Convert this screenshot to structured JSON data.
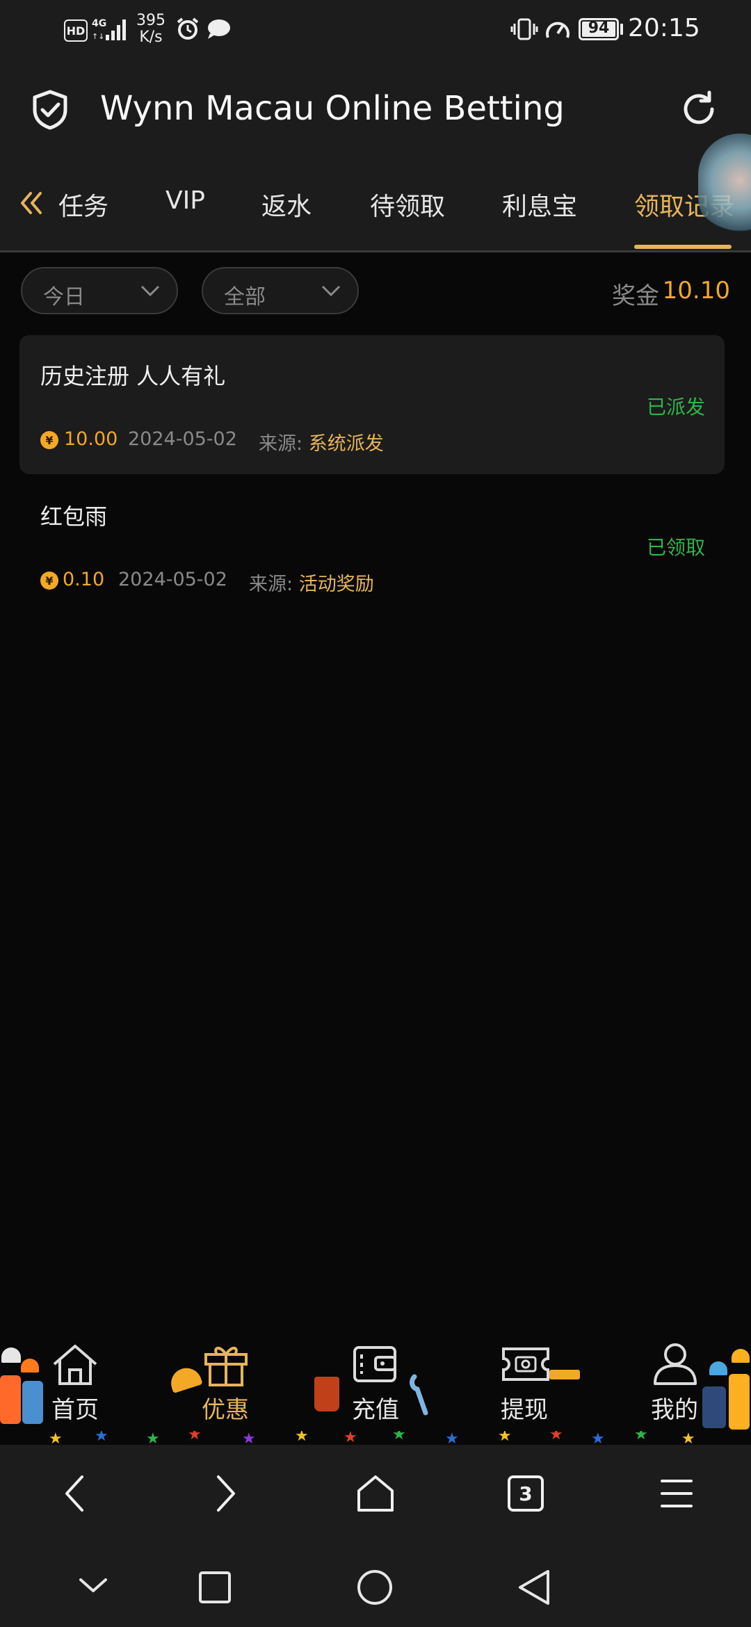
{
  "status_bar": {
    "hd": "HD",
    "network": "4G",
    "speed_value": "395",
    "speed_unit": "K/s",
    "battery": "94",
    "time": "20:15"
  },
  "header": {
    "title": "Wynn Macau Online Betting",
    "icons": [
      "shield-check-icon",
      "refresh-icon"
    ]
  },
  "tabs": {
    "items": [
      {
        "label": "任务"
      },
      {
        "label": "VIP"
      },
      {
        "label": "返水"
      },
      {
        "label": "待领取"
      },
      {
        "label": "利息宝"
      },
      {
        "label": "领取记录"
      }
    ],
    "active_index": 5
  },
  "filters": {
    "date": "今日",
    "type": "全部",
    "bonus_label": "奖金",
    "bonus_value": "10.10"
  },
  "records": [
    {
      "title": "历史注册 人人有礼",
      "status": "已派发",
      "amount": "10.00",
      "date": "2024-05-02",
      "source_label": "来源:",
      "source": "系统派发"
    },
    {
      "title": "红包雨",
      "status": "已领取",
      "amount": "0.10",
      "date": "2024-05-02",
      "source_label": "来源:",
      "source": "活动奖励"
    }
  ],
  "bottom_nav": {
    "items": [
      {
        "label": "首页",
        "icon": "home-icon"
      },
      {
        "label": "优惠",
        "icon": "gift-icon"
      },
      {
        "label": "充值",
        "icon": "wallet-icon"
      },
      {
        "label": "提现",
        "icon": "withdraw-ticket-icon"
      },
      {
        "label": "我的",
        "icon": "profile-icon"
      }
    ],
    "active_index": 1
  },
  "browser_bar": {
    "tab_count": "3"
  },
  "colors": {
    "accent_gold": "#e6b45a",
    "amount_orange": "#f3a826",
    "status_green": "#2fb54a",
    "bg": "#080808",
    "panel": "#1c1c1c"
  }
}
